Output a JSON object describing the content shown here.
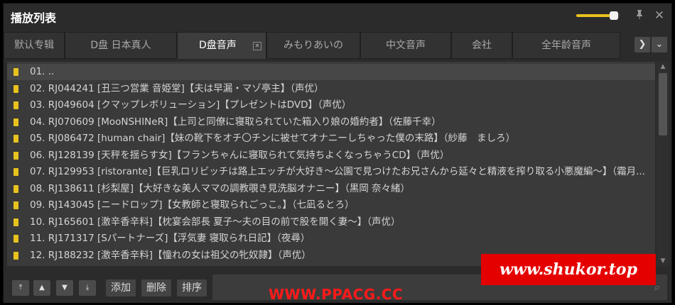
{
  "window": {
    "title": "播放列表"
  },
  "volume": {
    "level_percent": 85
  },
  "tabs": [
    {
      "label": "默认专辑",
      "active": false
    },
    {
      "label": "D盘 日本真人",
      "active": false
    },
    {
      "label": "D盘音声",
      "active": true
    },
    {
      "label": "みもりあいの",
      "active": false
    },
    {
      "label": "中文音声",
      "active": false
    },
    {
      "label": "会社",
      "active": false
    },
    {
      "label": "全年龄音声",
      "active": false
    }
  ],
  "tab_close_glyph": "✕",
  "playlist": [
    "01. ..",
    "02. RJ044241 [丑三つ営業 音姫堂]【夫は早漏・マゾ亭主】（声优）",
    "03. RJ049604 [クマップレボリューション]【プレゼントはDVD】（声优）",
    "04. RJ070609 [MooNSHINeR]【上司と同僚に寝取られていた箱入り娘の婚約者】（佐藤千幸）",
    "05. RJ086472 [human chair]【妹の靴下をオチ〇チンに被せてオナニーしちゃった僕の末路】（紗藤　ましろ）",
    "06. RJ128139 [天秤を揺らす女]【フランちゃんに寝取られて気持ちよくなっちゃうCD】（声优）",
    "07. RJ129953 [ristorante]【巨乳ロリビッチは路上エッチが大好き～公園で見つけたお兄さんから延々と精液を搾り取る小悪魔編～】（霜月...",
    "08. RJ138611 [杉梨屋]【大好きな美人ママの調教覗き見洗脳オナニー】（黒岡 奈々緒）",
    "09. RJ143045 [ニードロップ]【女教師と寝取られごっこ。】（七凪るとろ）",
    "10. RJ165601 [激辛香辛料]【枕宴会部長 夏子～夫の目の前で股を開く妻～】（声优）",
    "11. RJ171317 [Sパートナーズ]【浮気妻 寝取られ日記】（夜尋）",
    "12. RJ188232 [激辛香辛料]【憧れの女は祖父の牝奴隷】（声优）"
  ],
  "bottom": {
    "btn_add": "添加",
    "btn_delete": "删除",
    "btn_sort": "排序"
  },
  "watermarks": {
    "site1": "www.shukor.top",
    "site2": "WWW.PPACG.CC"
  },
  "colors": {
    "accent": "#e8c21d",
    "background": "#2b2b2b",
    "watermark_red": "#e50000"
  }
}
